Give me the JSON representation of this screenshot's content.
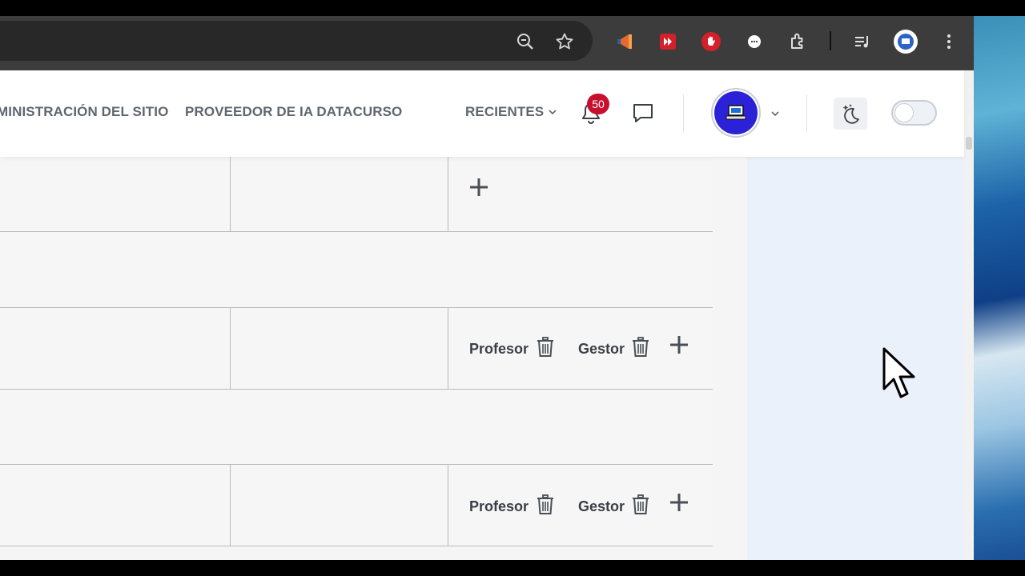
{
  "navbar": {
    "links": [
      {
        "label": "MINISTRACIÓN DEL SITIO"
      },
      {
        "label": "PROVEEDOR DE IA DATACURSO"
      }
    ],
    "recent_label": "RECIENTES",
    "notifications_count": "50"
  },
  "table": {
    "rows": [
      {
        "roles": []
      },
      {
        "roles": []
      },
      {
        "roles": [
          "Profesor",
          "Gestor"
        ]
      },
      {
        "roles": []
      },
      {
        "roles": [
          "Profesor",
          "Gestor"
        ]
      }
    ],
    "role_profesor": "Profesor",
    "role_gestor": "Gestor"
  },
  "colors": {
    "badge": "#c8102e",
    "avatar": "#2b22d8",
    "drawer": "#eaf1fa"
  },
  "icons": {
    "toolbar": [
      "zoom-icon",
      "star-icon",
      "megaphone-extension-icon",
      "video-extension-icon",
      "hand-extension-icon",
      "chat-extension-icon",
      "puzzle-extensions-icon",
      "media-queue-icon",
      "profile-icon",
      "kebab-menu-icon"
    ],
    "navbar": [
      "bell-icon",
      "message-icon",
      "chevron-down-icon",
      "theme-moon-icon"
    ],
    "table": [
      "plus-icon",
      "trash-icon"
    ]
  }
}
